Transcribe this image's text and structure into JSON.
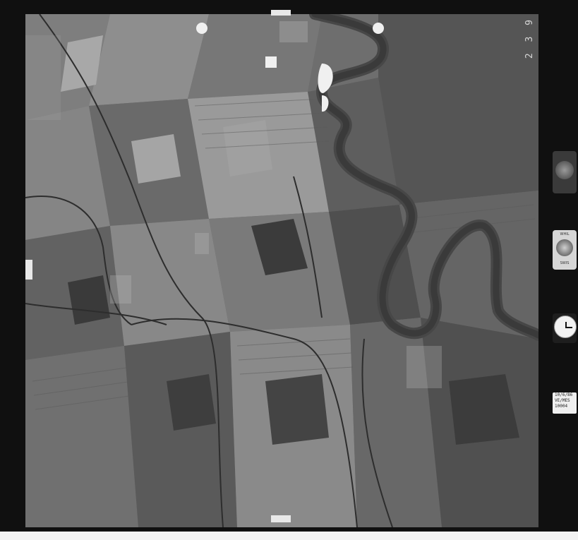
{
  "photo": {
    "frame_number": "2 3 9",
    "label_card": {
      "date": "10/6/86",
      "line2": "VE/MES",
      "line3": "10004"
    },
    "level_caption_top": "WHIL",
    "level_caption_bottom": "SWIS"
  },
  "instruments": [
    {
      "name": "altimeter-gauge"
    },
    {
      "name": "level-bubble"
    },
    {
      "name": "clock-gauge"
    }
  ],
  "colors": {
    "frame": "#101010",
    "river": "#4a4a4a",
    "field_light": "#9a9a9a",
    "field_dark": "#3b3b3b"
  }
}
